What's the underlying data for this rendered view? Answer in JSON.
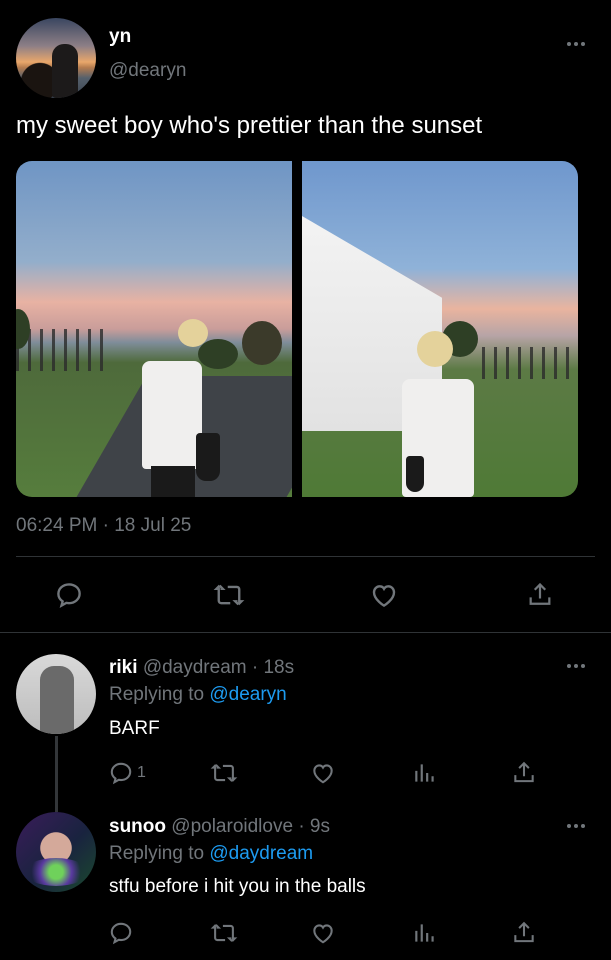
{
  "main_tweet": {
    "author_name": "yn",
    "handle": "@dearyn",
    "text": "my sweet boy who's prettier than the sunset",
    "timestamp": "06:24 PM · 18 Jul 25",
    "media": [
      "photo-boy-sunset-path",
      "photo-boy-tent"
    ]
  },
  "replies": [
    {
      "author_name": "riki",
      "handle": "@daydream",
      "time": "· 18s",
      "replying_prefix": "Replying to",
      "replying_to": "@dearyn",
      "text": "BARF",
      "reply_count": "1"
    },
    {
      "author_name": "sunoo",
      "handle": "@polaroidlove",
      "time": "· 9s",
      "replying_prefix": "Replying to",
      "replying_to": "@daydream",
      "text": "stfu before i hit you in the balls",
      "reply_count": ""
    }
  ],
  "icons": [
    "more-icon",
    "reply-icon",
    "retweet-icon",
    "like-icon",
    "share-icon",
    "views-icon"
  ],
  "colors": {
    "background": "#000000",
    "text": "#e7e9ea",
    "muted": "#71767b",
    "link": "#1d9bf0",
    "divider": "#2f3336"
  }
}
